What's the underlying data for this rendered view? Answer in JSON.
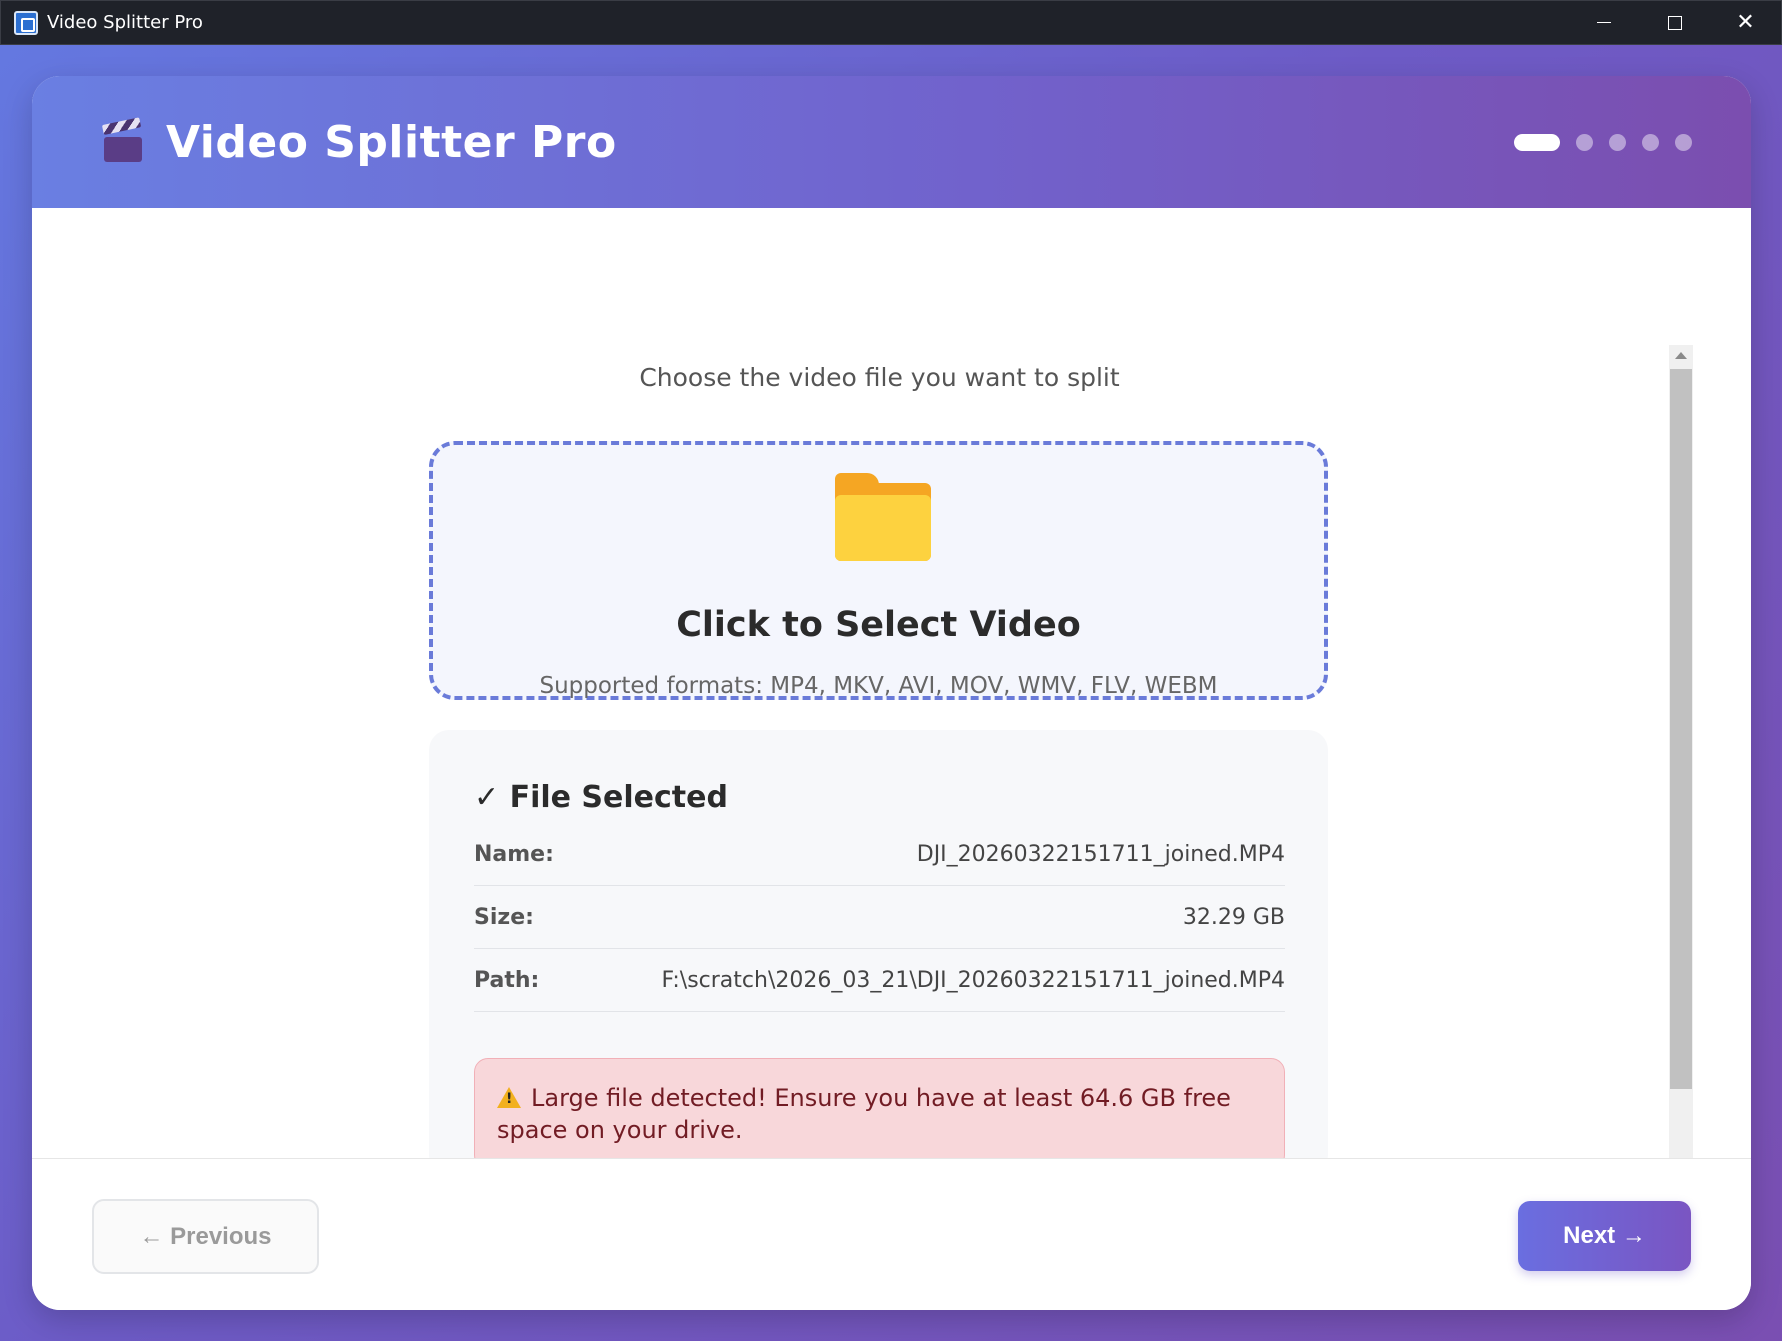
{
  "window": {
    "title": "Video Splitter Pro",
    "controls": {
      "minimize": "minimize",
      "maximize": "maximize",
      "close": "✕"
    }
  },
  "header": {
    "app_title": "Video Splitter Pro",
    "icon": "clapperboard-icon",
    "steps_total": 5,
    "current_step": 1
  },
  "main": {
    "subtitle": "Choose the video file you want to split",
    "dropzone": {
      "icon": "folder-icon",
      "title": "Click to Select Video",
      "formats": "Supported formats: MP4, MKV, AVI, MOV, WMV, FLV, WEBM"
    },
    "file_info": {
      "title": "✓ File Selected",
      "rows": [
        {
          "label": "Name:",
          "value": "DJI_20260322151711_joined.MP4"
        },
        {
          "label": "Size:",
          "value": "32.29 GB"
        },
        {
          "label": "Path:",
          "value": "F:\\scratch\\2026_03_21\\DJI_20260322151711_joined.MP4"
        }
      ],
      "warning": "Large file detected! Ensure you have at least 64.6 GB free space on your drive."
    }
  },
  "footer": {
    "previous_label": "← Previous",
    "next_label": "Next →"
  },
  "colors": {
    "accent": "#6a6ee0",
    "header_gradient_start": "#6a7fe2",
    "header_gradient_end": "#7b4eaf",
    "warning_bg": "#f8d7da",
    "warning_text": "#721c24"
  }
}
